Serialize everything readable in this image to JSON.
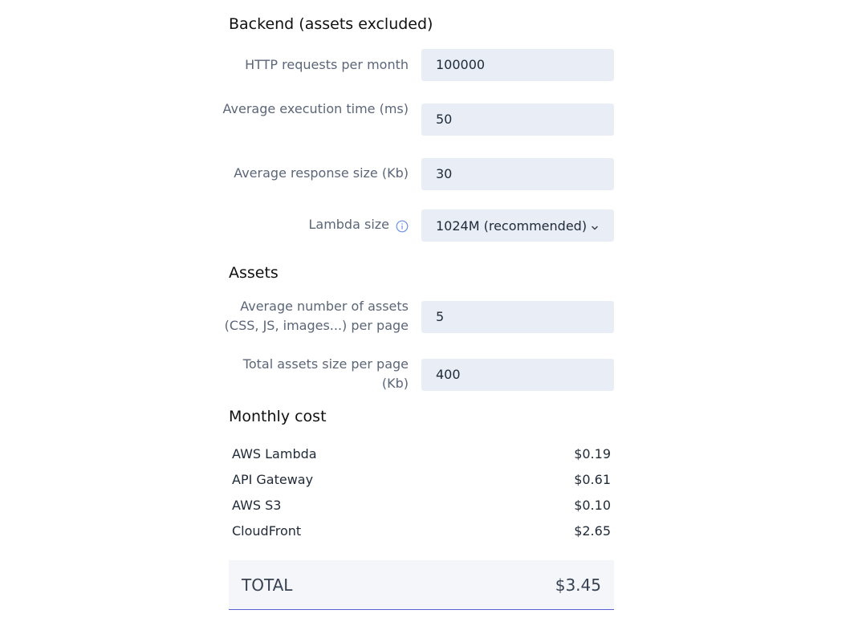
{
  "backend": {
    "title": "Backend (assets excluded)",
    "http_requests": {
      "label": "HTTP requests per month",
      "value": "100000"
    },
    "exec_time": {
      "label": "Average execution time (ms)",
      "value": "50"
    },
    "response_size": {
      "label": "Average response size (Kb)",
      "value": "30"
    },
    "lambda_size": {
      "label": "Lambda size",
      "selected": "1024M (recommended)",
      "icon": "info-icon"
    }
  },
  "assets": {
    "title": "Assets",
    "count": {
      "label": "Average number of assets (CSS, JS, images...) per page",
      "value": "5"
    },
    "total_size": {
      "label": "Total assets size per page (Kb)",
      "value": "400"
    }
  },
  "monthly": {
    "title": "Monthly cost",
    "items": [
      {
        "name": "AWS Lambda",
        "cost": "$0.19"
      },
      {
        "name": "API Gateway",
        "cost": "$0.61"
      },
      {
        "name": "AWS S3",
        "cost": "$0.10"
      },
      {
        "name": "CloudFront",
        "cost": "$2.65"
      }
    ],
    "total_label": "TOTAL",
    "total_value": "$3.45"
  },
  "colors": {
    "field_bg": "#e9edf5",
    "accent": "#5b5fd6",
    "info_icon": "#6b8fe0"
  }
}
